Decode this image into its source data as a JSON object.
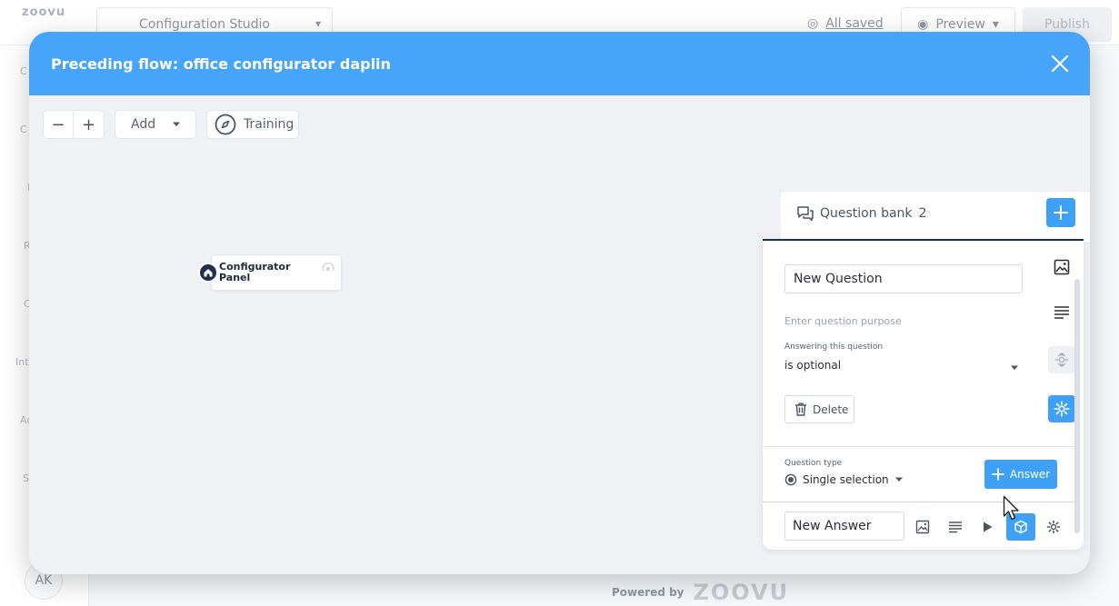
{
  "background": {
    "logo": "zoovu",
    "studio_label": "Configuration Studio",
    "saved_label": "All saved",
    "preview_label": "Preview",
    "publish_label": "Publish",
    "sidebar_items": [
      "C",
      "C",
      "I",
      "R",
      "C",
      "Int",
      "Ad",
      "S"
    ],
    "avatar_initials": "AK",
    "powered_label": "Powered by",
    "powered_brand": "ZOOVU"
  },
  "modal": {
    "title": "Preceding flow: office configurator daplin",
    "toolbar": {
      "zoom_out": "−",
      "zoom_in": "+",
      "add_label": "Add",
      "training_label": "Training"
    },
    "node": {
      "label": "Configurator Panel"
    },
    "question_bank": {
      "title": "Question bank",
      "count": "2"
    },
    "question": {
      "name_value": "New Question",
      "purpose_placeholder": "Enter question purpose",
      "answering_label": "Answering this question",
      "answering_value": "is optional",
      "delete_label": "Delete",
      "type_label": "Question type",
      "type_value": "Single selection",
      "answer_button": "Answer",
      "answer_value": "New Answer"
    }
  },
  "colors": {
    "header_blue": "#46a5fb",
    "accent_blue": "#3fa0f8",
    "navy": "#1f2f4f"
  },
  "icons": [
    "close-icon",
    "compass-icon",
    "caret-down-icon",
    "home-icon",
    "chat-icon",
    "plus-icon",
    "image-icon",
    "text-icon",
    "logic-icon",
    "gear-icon",
    "trash-icon",
    "radio-icon",
    "play-icon",
    "cube-icon",
    "cursor-icon"
  ]
}
